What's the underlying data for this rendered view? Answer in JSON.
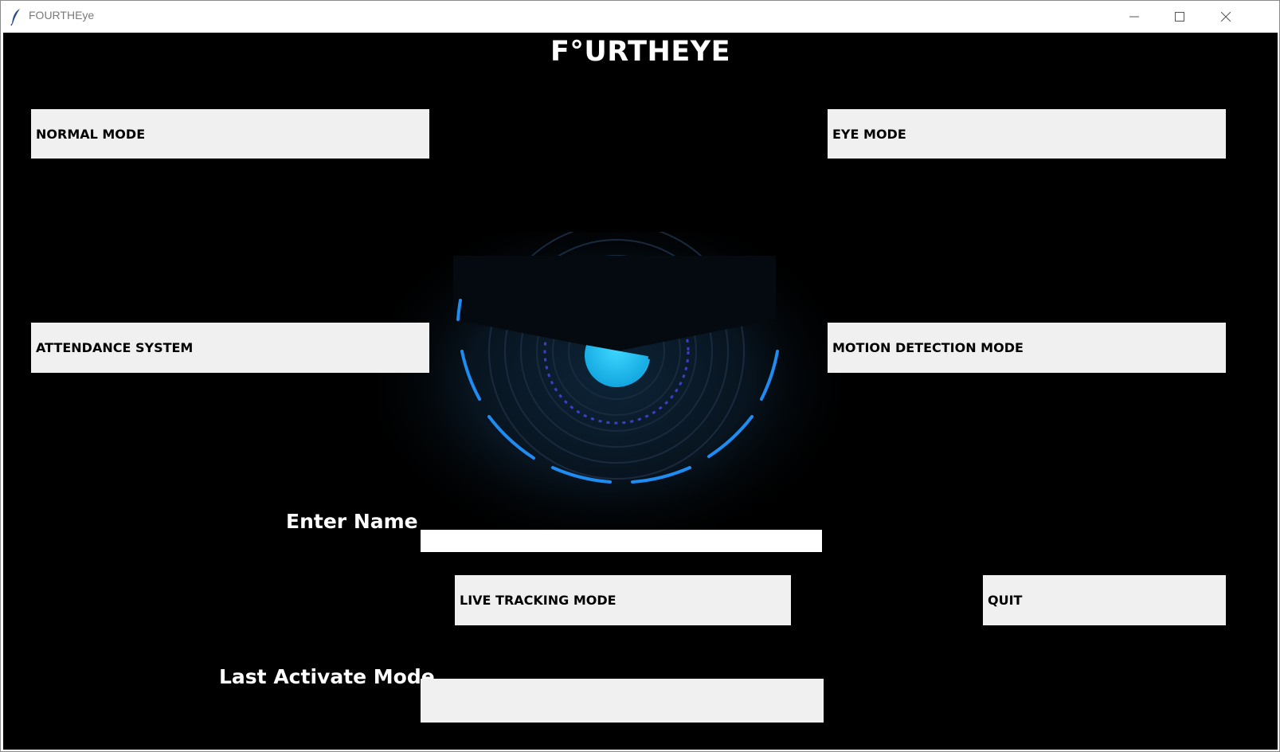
{
  "window": {
    "title": "FOURTHEye",
    "controls": [
      "minimize-icon",
      "maximize-icon",
      "close-icon"
    ]
  },
  "app": {
    "heading": "F°URTHEYE"
  },
  "buttons": {
    "normal_mode": "NORMAL MODE",
    "eye_mode": "EYE MODE",
    "attendance_system": "ATTENDANCE SYSTEM",
    "motion_detection_mode": "MOTION DETECTION MODE",
    "live_tracking_mode": "LIVE TRACKING MODE",
    "quit": "QUIT"
  },
  "form": {
    "name_label": "Enter Name",
    "name_value": "",
    "last_mode_label": "Last Activate Mode",
    "last_mode_value": ""
  },
  "colors": {
    "background": "#000000",
    "button_bg": "#f0f0f0",
    "eye_accent": "#1e8cf0",
    "pupil": "#1ec8f5"
  }
}
